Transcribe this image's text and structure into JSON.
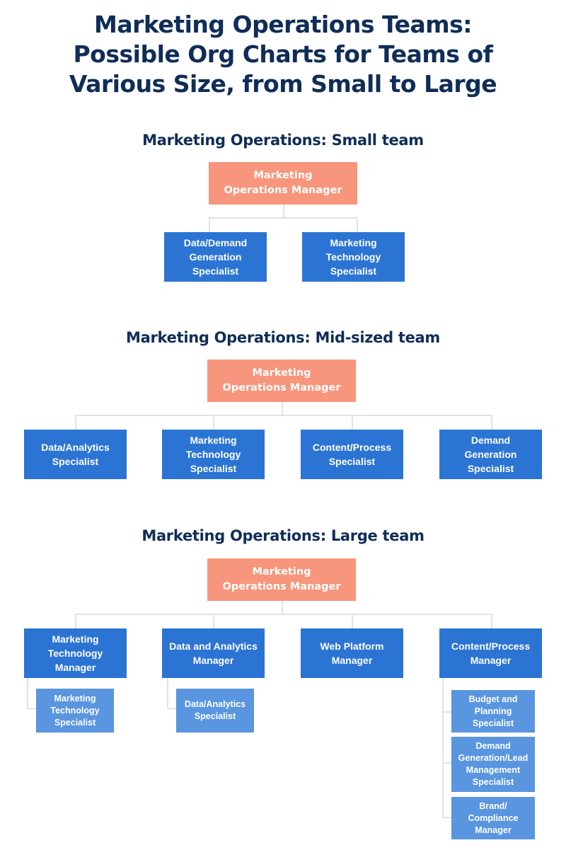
{
  "title": {
    "line1": "Marketing Operations Teams:",
    "line2": "Possible Org Charts for Teams of",
    "line3": "Various Size, from Small to Large"
  },
  "colors": {
    "title": "#0f2d57",
    "manager_box": "#f7967c",
    "role_box": "#2b74d3",
    "sub_role_box": "#5a95df",
    "connector": "#dfe2e7"
  },
  "small_team": {
    "heading": "Marketing Operations: Small team",
    "manager": {
      "line1": "Marketing",
      "line2": "Operations Manager"
    },
    "roles": [
      {
        "lines": [
          "Data/Demand",
          "Generation",
          "Specialist"
        ]
      },
      {
        "lines": [
          "Marketing",
          "Technology",
          "Specialist"
        ]
      }
    ]
  },
  "mid_team": {
    "heading": "Marketing Operations: Mid-sized team",
    "manager": {
      "line1": "Marketing",
      "line2": "Operations Manager"
    },
    "roles": [
      {
        "lines": [
          "Data/Analytics",
          "Specialist"
        ]
      },
      {
        "lines": [
          "Marketing",
          "Technology",
          "Specialist"
        ]
      },
      {
        "lines": [
          "Content/Process",
          "Specialist"
        ]
      },
      {
        "lines": [
          "Demand",
          "Generation",
          "Specialist"
        ]
      }
    ]
  },
  "large_team": {
    "heading": "Marketing Operations: Large team",
    "manager": {
      "line1": "Marketing",
      "line2": "Operations Manager"
    },
    "roles": [
      {
        "lines": [
          "Marketing",
          "Technology",
          "Manager"
        ],
        "reports": [
          {
            "lines": [
              "Marketing",
              "Technology",
              "Specialist"
            ]
          }
        ]
      },
      {
        "lines": [
          "Data and Analytics",
          "Manager"
        ],
        "reports": [
          {
            "lines": [
              "Data/Analytics",
              "Specialist"
            ]
          }
        ]
      },
      {
        "lines": [
          "Web Platform",
          "Manager"
        ],
        "reports": []
      },
      {
        "lines": [
          "Content/Process",
          "Manager"
        ],
        "reports": [
          {
            "lines": [
              "Budget and",
              "Planning",
              "Specialist"
            ]
          },
          {
            "lines": [
              "Demand",
              "Generation/Lead",
              "Management",
              "Specialist"
            ]
          },
          {
            "lines": [
              "Brand/",
              "Compliance",
              "Manager"
            ]
          }
        ]
      }
    ]
  }
}
